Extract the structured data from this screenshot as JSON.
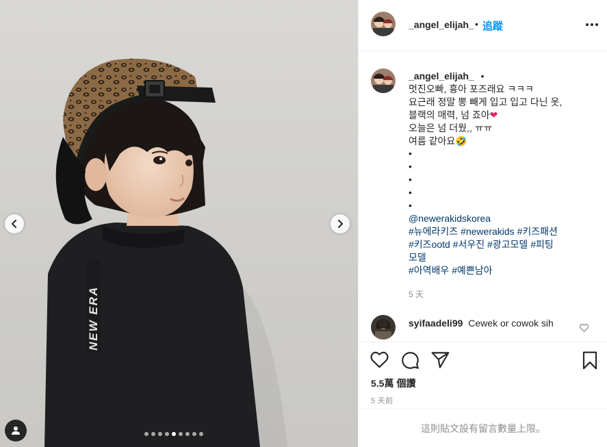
{
  "post": {
    "username": "_angel_elijah_",
    "separator": "•",
    "follow_label": "追蹤",
    "more_icon": "more-options-icon"
  },
  "caption": {
    "username": "_angel_elijah_",
    "trailing_dot": "•",
    "lines": [
      "멋진오빠, 흉아 포즈래요 ㅋㅋㅋ",
      "요근래 정말 뽕 빼게 입고 입고 다닌 옷,",
      "블랙의 매력, 넘 죠아",
      "오늘은 넘 더웠,, ㅠㅠ",
      "여름 같아요",
      "•",
      "•",
      "•",
      "•",
      "•"
    ],
    "emoji": {
      "heart": "❤",
      "smile": "🤣"
    },
    "mention": "@newerakidskorea",
    "hashtag_lines": [
      "#뉴에라키즈 #newerakids #키즈패션",
      "#키즈ootd #서우진 #광고모델 #피팅",
      "모델",
      "#아역배우 #예쁜남아"
    ],
    "time": "5 天"
  },
  "comment": {
    "username": "syifaadeli99",
    "text": "Cewek or cowok sih"
  },
  "stats": {
    "likes_count": "5.5萬",
    "likes_label": "個讚",
    "posted": "5 天前"
  },
  "footer": {
    "limit_text": "這則貼文設有留言數量上限。"
  },
  "carousel": {
    "total": 9,
    "active": 5
  },
  "colors": {
    "follow_blue": "#0095f6",
    "hashtag": "#00376b",
    "muted": "#8e8e8e",
    "border": "#efefef"
  }
}
